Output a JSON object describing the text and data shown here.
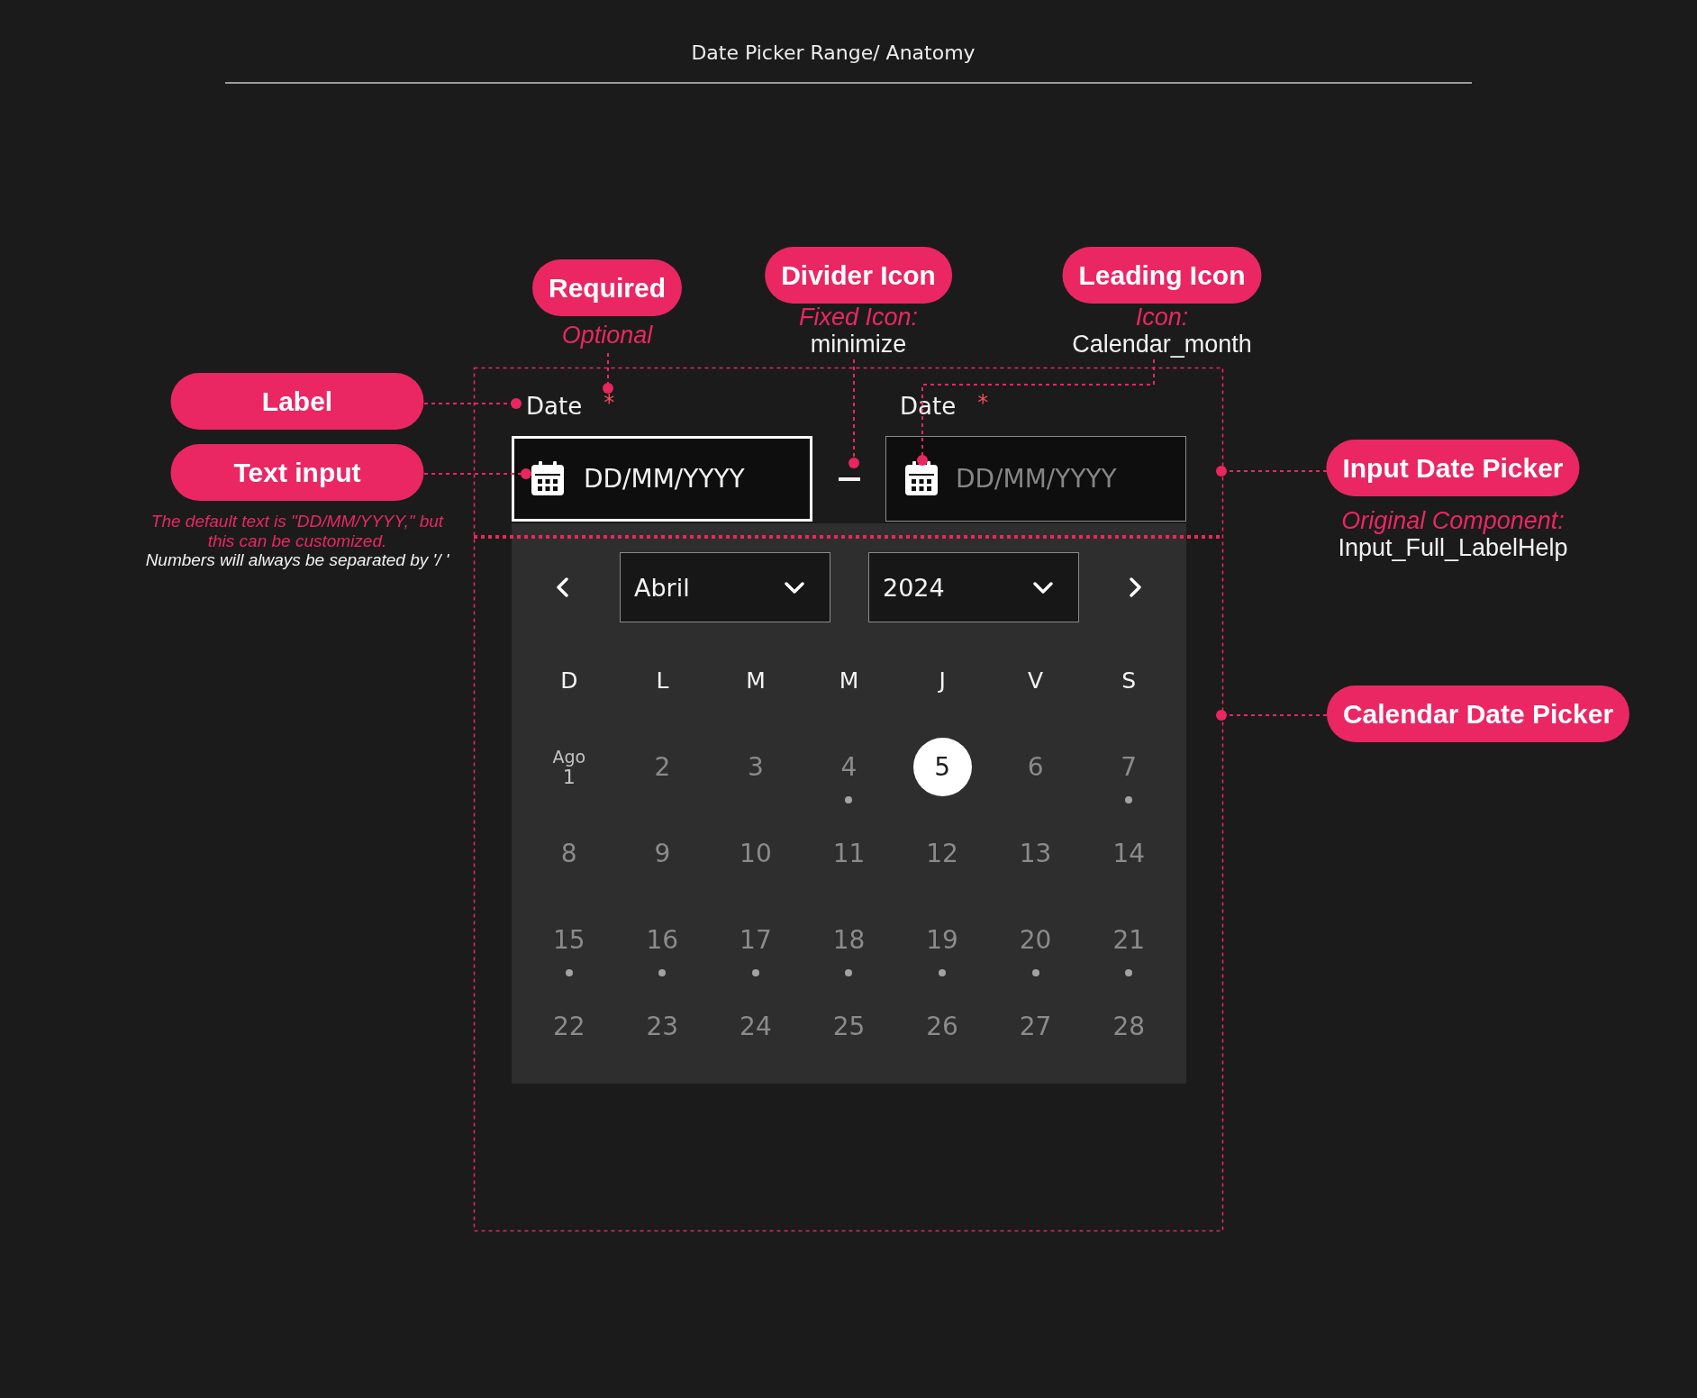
{
  "title": "Date Picker Range/ Anatomy",
  "date_range_picker": {
    "inputs": [
      {
        "label": "Date",
        "required_mark": "*",
        "placeholder": "DD/MM/YYYY",
        "focused": true
      },
      {
        "label": "Date",
        "required_mark": "*",
        "placeholder": "DD/MM/YYYY",
        "focused": false
      }
    ],
    "calendar": {
      "month": "Abril",
      "year": "2024",
      "weekdays": [
        "D",
        "L",
        "M",
        "M",
        "J",
        "V",
        "S"
      ],
      "days": [
        {
          "month_label": "Ago",
          "label": "1",
          "selected": false,
          "marked": false
        },
        {
          "label": "2",
          "selected": false,
          "marked": false
        },
        {
          "label": "3",
          "selected": false,
          "marked": false
        },
        {
          "label": "4",
          "selected": false,
          "marked": true
        },
        {
          "label": "5",
          "selected": true,
          "marked": false
        },
        {
          "label": "6",
          "selected": false,
          "marked": false
        },
        {
          "label": "7",
          "selected": false,
          "marked": true
        },
        {
          "label": "8",
          "selected": false,
          "marked": false
        },
        {
          "label": "9",
          "selected": false,
          "marked": false
        },
        {
          "label": "10",
          "selected": false,
          "marked": false
        },
        {
          "label": "11",
          "selected": false,
          "marked": false
        },
        {
          "label": "12",
          "selected": false,
          "marked": false
        },
        {
          "label": "13",
          "selected": false,
          "marked": false
        },
        {
          "label": "14",
          "selected": false,
          "marked": false
        },
        {
          "label": "15",
          "selected": false,
          "marked": true
        },
        {
          "label": "16",
          "selected": false,
          "marked": true
        },
        {
          "label": "17",
          "selected": false,
          "marked": true
        },
        {
          "label": "18",
          "selected": false,
          "marked": true
        },
        {
          "label": "19",
          "selected": false,
          "marked": true
        },
        {
          "label": "20",
          "selected": false,
          "marked": true
        },
        {
          "label": "21",
          "selected": false,
          "marked": true
        },
        {
          "label": "22",
          "selected": false,
          "marked": false
        },
        {
          "label": "23",
          "selected": false,
          "marked": false
        },
        {
          "label": "24",
          "selected": false,
          "marked": false
        },
        {
          "label": "25",
          "selected": false,
          "marked": false
        },
        {
          "label": "26",
          "selected": false,
          "marked": false
        },
        {
          "label": "27",
          "selected": false,
          "marked": false
        },
        {
          "label": "28",
          "selected": false,
          "marked": false
        }
      ]
    }
  },
  "callouts": [
    {
      "title": "Required",
      "notes": [
        {
          "kind": "accent",
          "text": "Optional"
        }
      ]
    },
    {
      "title": "Divider Icon",
      "notes": [
        {
          "kind": "accent",
          "text": "Fixed Icon:"
        },
        {
          "kind": "value",
          "text": "minimize"
        }
      ]
    },
    {
      "title": "Leading Icon",
      "notes": [
        {
          "kind": "accent",
          "text": "Icon:"
        },
        {
          "kind": "value",
          "text": "Calendar_month"
        }
      ]
    },
    {
      "title": "Label"
    },
    {
      "title": "Text input",
      "notes": [
        {
          "kind": "caption",
          "text": "The default text is \"DD/MM/YYYY,\" but this can be customized."
        },
        {
          "kind": "footnote",
          "text": "Numbers will always be separated by '/ '"
        }
      ]
    },
    {
      "title": "Input Date Picker",
      "notes": [
        {
          "kind": "accent",
          "text": "Original Component:"
        },
        {
          "kind": "value",
          "text": "Input_Full_LabelHelp"
        }
      ]
    },
    {
      "title": "Calendar Date Picker"
    }
  ]
}
